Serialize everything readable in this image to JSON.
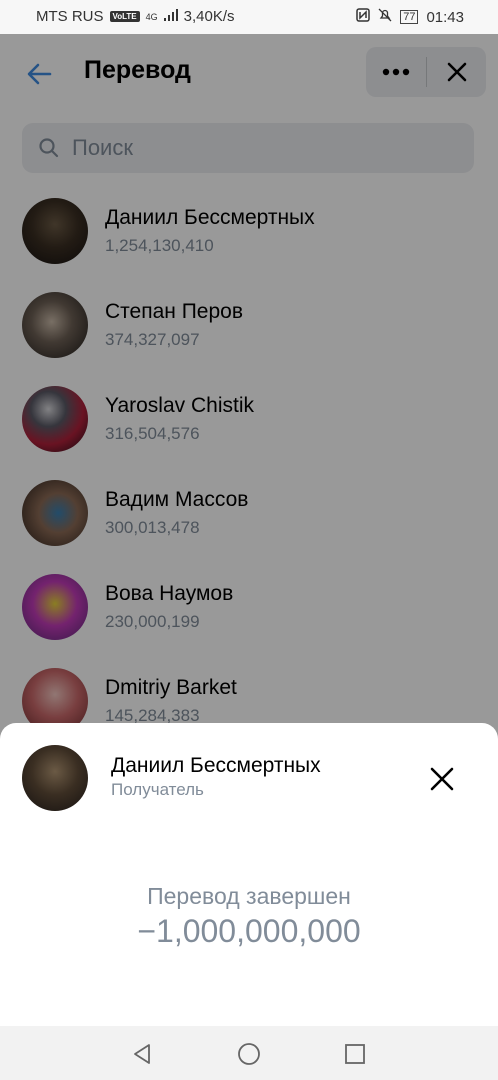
{
  "status": {
    "carrier": "MTS RUS",
    "volte": "VoLTE",
    "network": "4G",
    "speed": "3,40K/s",
    "battery": "77",
    "time": "01:43"
  },
  "header": {
    "title": "Перевод"
  },
  "search": {
    "placeholder": "Поиск"
  },
  "contacts": [
    {
      "name": "Даниил Бессмертных",
      "value": "1,254,130,410"
    },
    {
      "name": "Степан Перов",
      "value": "374,327,097"
    },
    {
      "name": "Yaroslav Chistik",
      "value": "316,504,576"
    },
    {
      "name": "Вадим Массов",
      "value": "300,013,478"
    },
    {
      "name": "Вова Наумов",
      "value": "230,000,199"
    },
    {
      "name": "Dmitriy Barket",
      "value": "145,284,383"
    }
  ],
  "sheet": {
    "recipient_name": "Даниил Бессмертных",
    "recipient_role": "Получатель",
    "status_text": "Перевод завершен",
    "amount": "−1,000,000,000"
  },
  "colors": {
    "accent": "#3f8ae0",
    "secondary_text": "#818c99",
    "field_bg": "#ebedf0"
  },
  "icons": [
    "back-arrow-icon",
    "more-icon",
    "close-icon",
    "search-icon",
    "nav-back-icon",
    "nav-home-icon",
    "nav-recents-icon"
  ]
}
